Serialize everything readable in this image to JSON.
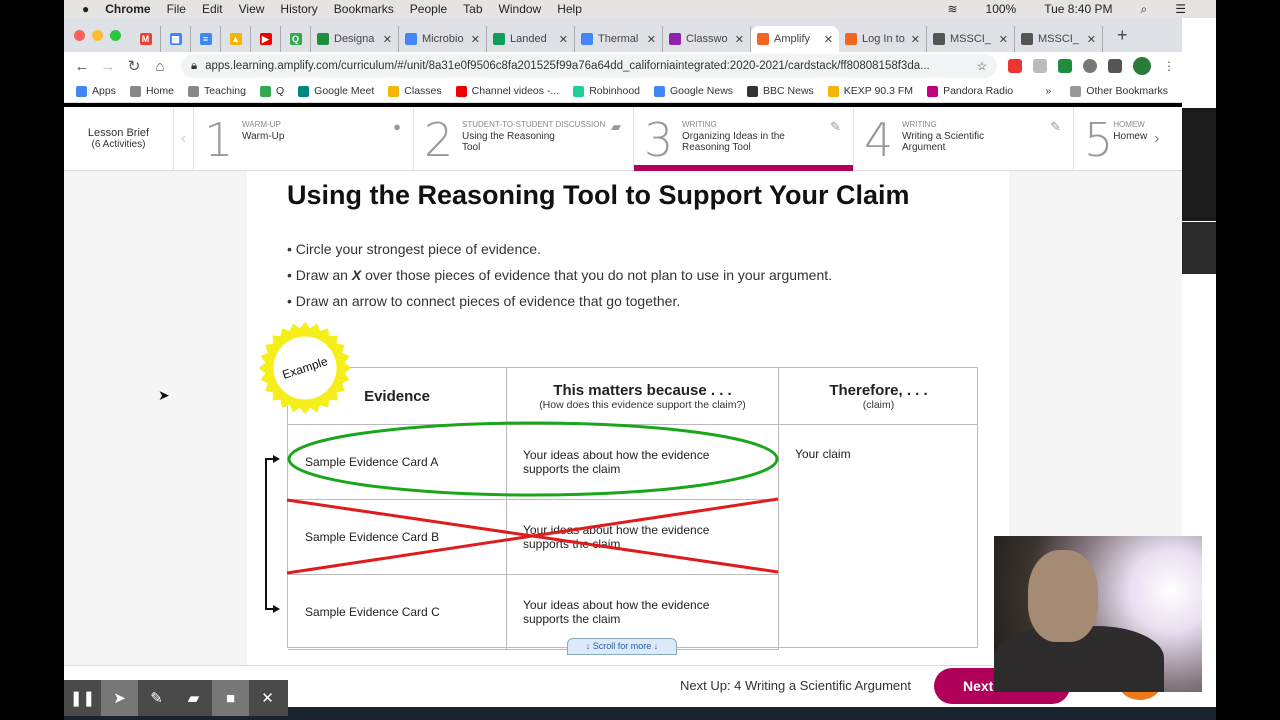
{
  "menubar": {
    "items": [
      "Chrome",
      "File",
      "Edit",
      "View",
      "History",
      "Bookmarks",
      "People",
      "Tab",
      "Window",
      "Help"
    ],
    "battery": "100%",
    "clock": "Tue 8:40 PM"
  },
  "tabs": [
    {
      "title": "Designa",
      "color": "#1e8e3e"
    },
    {
      "title": "Microbio",
      "color": "#4285f4"
    },
    {
      "title": "Landed",
      "color": "#0f9d58"
    },
    {
      "title": "Thermal",
      "color": "#4285f4"
    },
    {
      "title": "Classwo",
      "color": "#8e24aa"
    },
    {
      "title": "Amplify",
      "color": "#f26522",
      "active": true
    },
    {
      "title": "Log In to",
      "color": "#f26522"
    },
    {
      "title": "MSSCI_",
      "color": "#555555"
    },
    {
      "title": "MSSCI_",
      "color": "#555555"
    }
  ],
  "address": {
    "url": "apps.learning.amplify.com/curriculum/#/unit/8a31e0f9506c8fa201525f99a76a64dd_californiaintegrated:2020-2021/cardstack/ff80808158f3da..."
  },
  "bookmarks": [
    {
      "label": "Apps",
      "color": "#4285f4"
    },
    {
      "label": "Home",
      "color": "#888"
    },
    {
      "label": "Teaching",
      "color": "#888"
    },
    {
      "label": "Q",
      "color": "#34a853"
    },
    {
      "label": "Google Meet",
      "color": "#00897b"
    },
    {
      "label": "Classes",
      "color": "#f4b400"
    },
    {
      "label": "Channel videos -...",
      "color": "#e00"
    },
    {
      "label": "Robinhood",
      "color": "#21ce99"
    },
    {
      "label": "Google News",
      "color": "#4285f4"
    },
    {
      "label": "BBC News",
      "color": "#333"
    },
    {
      "label": "KEXP 90.3 FM",
      "color": "#f4b400"
    },
    {
      "label": "Pandora Radio",
      "color": "#c0007a"
    }
  ],
  "other_bookmarks": "Other Bookmarks",
  "lesson": {
    "brief": "Lesson Brief",
    "count": "(6 Activities)",
    "activities": [
      {
        "num": "1",
        "cat": "Warm-Up",
        "name": "Warm-Up",
        "icon": "lightbulb-icon"
      },
      {
        "num": "2",
        "cat": "Student-to-Student Discussion",
        "name": "Using the Reasoning Tool",
        "icon": "chat-icon"
      },
      {
        "num": "3",
        "cat": "Writing",
        "name": "Organizing Ideas in the Reasoning Tool",
        "icon": "pencil-icon",
        "current": true
      },
      {
        "num": "4",
        "cat": "Writing",
        "name": "Writing a Scientific Argument",
        "icon": "pencil-icon"
      },
      {
        "num": "5",
        "cat": "Homew",
        "name": "Homew"
      }
    ]
  },
  "page": {
    "title": "Using the Reasoning Tool to Support Your Claim",
    "bullets": [
      "Circle your strongest piece of evidence.",
      "over those pieces of evidence that you do not plan to use in your argument.",
      "Draw an arrow to connect pieces of evidence that go together."
    ],
    "bullet2_prefix": "Draw an ",
    "bullet2_x": "X",
    "badge": "Example",
    "table": {
      "headers": [
        {
          "title": "Evidence"
        },
        {
          "title": "This matters because . . .",
          "sub": "(How does this evidence support the claim?)"
        },
        {
          "title": "Therefore, . . .",
          "sub": "(claim)"
        }
      ],
      "rows": [
        {
          "evidence": "Sample Evidence Card A",
          "reason": "Your ideas about how the evidence supports the claim",
          "mark": "circled"
        },
        {
          "evidence": "Sample Evidence Card B",
          "reason": "Your ideas about how the evidence supports the claim",
          "mark": "crossed"
        },
        {
          "evidence": "Sample Evidence Card C",
          "reason": "Your ideas about how the evidence supports the claim"
        }
      ],
      "claim": "Your claim"
    },
    "scroll": "↓  Scroll for more  ↓"
  },
  "footer": {
    "next_up": "Next Up: 4 Writing a Scientific Argument",
    "next_button": "Next"
  },
  "colors": {
    "accent": "#b0005a",
    "circle": "#1aa61a",
    "cross": "#e01b1b",
    "badge": "#f5ee1a"
  }
}
